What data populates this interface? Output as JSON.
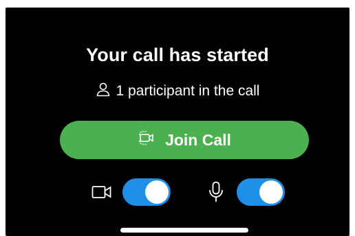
{
  "call": {
    "title": "Your call has started",
    "participants_text": "1 participant in the call",
    "join_label": "Join Call"
  },
  "controls": {
    "video": {
      "icon": "video-camera-icon",
      "enabled": true
    },
    "microphone": {
      "icon": "microphone-icon",
      "enabled": true
    }
  },
  "colors": {
    "background": "#000000",
    "join_button": "#4caf50",
    "toggle_on": "#1e90e8",
    "text": "#ffffff"
  },
  "icons": {
    "participant": "person-icon",
    "join": "video-join-icon"
  }
}
